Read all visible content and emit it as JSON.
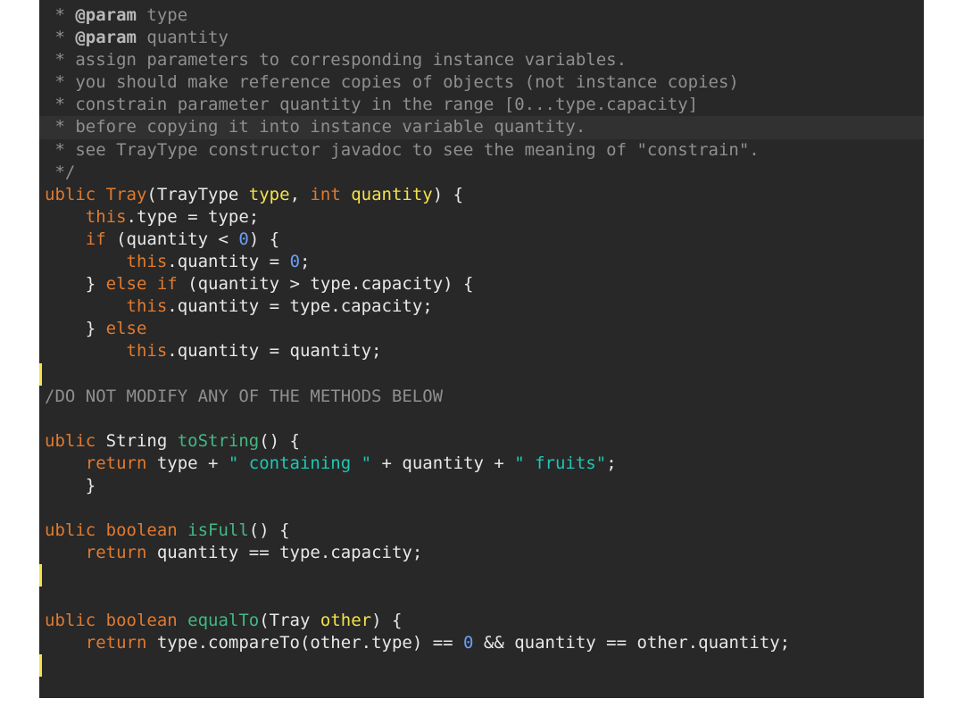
{
  "colors": {
    "editor_background": "#282828",
    "page_background": "#ffffff",
    "current_line": "#313131",
    "default_text": "#e8e8e8",
    "comment": "#8f8f8f",
    "comment_tag": "#b8b8b8",
    "keyword": "#e07a2f",
    "method_name": "#42b884",
    "parameter": "#f4e24a",
    "number": "#6c9ef8",
    "string": "#1ec7b4"
  },
  "lines": [
    {
      "tokens": [
        {
          "t": " * ",
          "c": "comment"
        },
        {
          "t": "@param",
          "c": "comment-tag"
        },
        {
          "t": " type",
          "c": "comment"
        }
      ]
    },
    {
      "tokens": [
        {
          "t": " * ",
          "c": "comment"
        },
        {
          "t": "@param",
          "c": "comment-tag"
        },
        {
          "t": " quantity",
          "c": "comment"
        }
      ]
    },
    {
      "tokens": [
        {
          "t": " * assign parameters to corresponding instance variables.",
          "c": "comment"
        }
      ]
    },
    {
      "tokens": [
        {
          "t": " * you should make reference copies of objects (not instance copies)",
          "c": "comment"
        }
      ]
    },
    {
      "tokens": [
        {
          "t": " * constrain parameter quantity in the range [0...type.capacity]",
          "c": "comment"
        }
      ]
    },
    {
      "highlight": true,
      "tokens": [
        {
          "t": " * before copying it into instance variable quantity.",
          "c": "comment"
        }
      ]
    },
    {
      "tokens": [
        {
          "t": " * see TrayType constructor javadoc to see the meaning of \"constrain\".",
          "c": "comment"
        }
      ]
    },
    {
      "tokens": [
        {
          "t": " */",
          "c": "comment"
        }
      ]
    },
    {
      "tokens": [
        {
          "t": "ublic ",
          "c": "keyword"
        },
        {
          "t": "Tray",
          "c": "ctor"
        },
        {
          "t": "(TrayType ",
          "c": "default"
        },
        {
          "t": "type",
          "c": "param"
        },
        {
          "t": ", ",
          "c": "default"
        },
        {
          "t": "int ",
          "c": "keyword"
        },
        {
          "t": "quantity",
          "c": "param"
        },
        {
          "t": ") {",
          "c": "default"
        }
      ]
    },
    {
      "tokens": [
        {
          "t": "    ",
          "c": "default"
        },
        {
          "t": "this",
          "c": "keyword"
        },
        {
          "t": ".type = type;",
          "c": "default"
        }
      ]
    },
    {
      "tokens": [
        {
          "t": "    ",
          "c": "default"
        },
        {
          "t": "if",
          "c": "keyword"
        },
        {
          "t": " (quantity < ",
          "c": "default"
        },
        {
          "t": "0",
          "c": "number"
        },
        {
          "t": ") {",
          "c": "default"
        }
      ]
    },
    {
      "tokens": [
        {
          "t": "        ",
          "c": "default"
        },
        {
          "t": "this",
          "c": "keyword"
        },
        {
          "t": ".quantity = ",
          "c": "default"
        },
        {
          "t": "0",
          "c": "number"
        },
        {
          "t": ";",
          "c": "default"
        }
      ]
    },
    {
      "tokens": [
        {
          "t": "    } ",
          "c": "default"
        },
        {
          "t": "else if",
          "c": "keyword"
        },
        {
          "t": " (quantity > type.capacity) {",
          "c": "default"
        }
      ]
    },
    {
      "tokens": [
        {
          "t": "        ",
          "c": "default"
        },
        {
          "t": "this",
          "c": "keyword"
        },
        {
          "t": ".quantity = type.capacity;",
          "c": "default"
        }
      ]
    },
    {
      "tokens": [
        {
          "t": "    } ",
          "c": "default"
        },
        {
          "t": "else",
          "c": "keyword"
        }
      ]
    },
    {
      "tokens": [
        {
          "t": "        ",
          "c": "default"
        },
        {
          "t": "this",
          "c": "keyword"
        },
        {
          "t": ".quantity = quantity;",
          "c": "default"
        }
      ]
    },
    {
      "mark": true,
      "tokens": [
        {
          "t": "",
          "c": "default"
        }
      ]
    },
    {
      "tokens": [
        {
          "t": "/DO NOT MODIFY ANY OF THE METHODS BELOW",
          "c": "comment"
        }
      ]
    },
    {
      "tokens": [
        {
          "t": "",
          "c": "default"
        }
      ]
    },
    {
      "tokens": [
        {
          "t": "ublic ",
          "c": "keyword"
        },
        {
          "t": "String ",
          "c": "default"
        },
        {
          "t": "toString",
          "c": "method"
        },
        {
          "t": "() {",
          "c": "default"
        }
      ]
    },
    {
      "tokens": [
        {
          "t": "    ",
          "c": "default"
        },
        {
          "t": "return",
          "c": "keyword"
        },
        {
          "t": " type + ",
          "c": "default"
        },
        {
          "t": "\" containing \"",
          "c": "string"
        },
        {
          "t": " + quantity + ",
          "c": "default"
        },
        {
          "t": "\" fruits\"",
          "c": "string"
        },
        {
          "t": ";",
          "c": "default"
        }
      ]
    },
    {
      "tokens": [
        {
          "t": "    }",
          "c": "default"
        }
      ]
    },
    {
      "tokens": [
        {
          "t": "",
          "c": "default"
        }
      ]
    },
    {
      "tokens": [
        {
          "t": "ublic ",
          "c": "keyword"
        },
        {
          "t": "boolean ",
          "c": "keyword"
        },
        {
          "t": "isFull",
          "c": "method"
        },
        {
          "t": "() {",
          "c": "default"
        }
      ]
    },
    {
      "tokens": [
        {
          "t": "    ",
          "c": "default"
        },
        {
          "t": "return",
          "c": "keyword"
        },
        {
          "t": " quantity == type.capacity;",
          "c": "default"
        }
      ]
    },
    {
      "mark": true,
      "tokens": [
        {
          "t": "",
          "c": "default"
        }
      ]
    },
    {
      "tokens": [
        {
          "t": "",
          "c": "default"
        }
      ]
    },
    {
      "tokens": [
        {
          "t": "ublic ",
          "c": "keyword"
        },
        {
          "t": "boolean ",
          "c": "keyword"
        },
        {
          "t": "equalTo",
          "c": "method"
        },
        {
          "t": "(Tray ",
          "c": "default"
        },
        {
          "t": "other",
          "c": "param"
        },
        {
          "t": ") {",
          "c": "default"
        }
      ]
    },
    {
      "tokens": [
        {
          "t": "    ",
          "c": "default"
        },
        {
          "t": "return",
          "c": "keyword"
        },
        {
          "t": " type.compareTo(other.type) == ",
          "c": "default"
        },
        {
          "t": "0",
          "c": "number"
        },
        {
          "t": " && quantity == other.quantity;",
          "c": "default"
        }
      ]
    },
    {
      "mark": true,
      "tokens": [
        {
          "t": "",
          "c": "default"
        }
      ]
    }
  ]
}
